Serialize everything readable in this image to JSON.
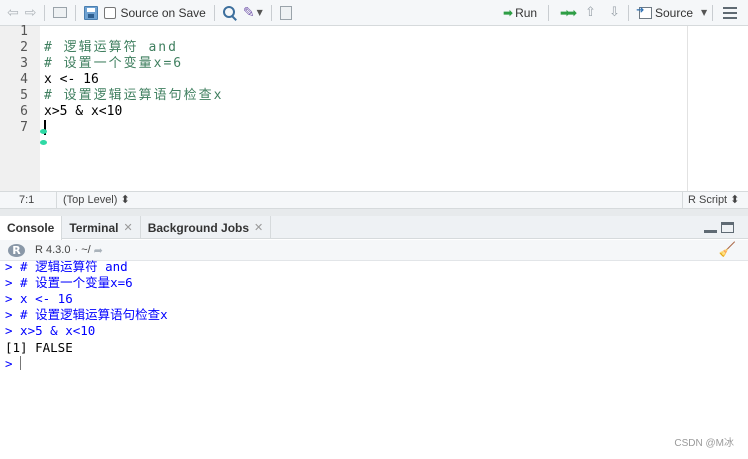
{
  "toolbar": {
    "source_on_save_label": "Source on Save",
    "run_label": "Run",
    "source_label": "Source"
  },
  "editor": {
    "lines": [
      {
        "num": "1",
        "text": ""
      },
      {
        "num": "2",
        "text": "# 逻辑运算符 and"
      },
      {
        "num": "3",
        "text": "# 设置一个变量x=6"
      },
      {
        "num": "4",
        "text": "x <- 16"
      },
      {
        "num": "5",
        "text": "# 设置逻辑运算语句检查x"
      },
      {
        "num": "6",
        "text": "x>5 & x<10"
      },
      {
        "num": "7",
        "text": ""
      }
    ]
  },
  "statusbar": {
    "position": "7:1",
    "scope": "(Top Level) ⬍",
    "file_type": "R Script ⬍"
  },
  "tabs": [
    {
      "label": "Console"
    },
    {
      "label": "Terminal"
    },
    {
      "label": "Background Jobs"
    }
  ],
  "console_header": {
    "r_version": "R 4.3.0",
    "wd": "· ~/"
  },
  "console": {
    "lines": [
      {
        "prompt": ">",
        "text": " # 逻辑运算符 and"
      },
      {
        "prompt": ">",
        "text": " # 设置一个变量x=6"
      },
      {
        "prompt": ">",
        "text": " x <- 16"
      },
      {
        "prompt": ">",
        "text": " # 设置逻辑运算语句检查x"
      },
      {
        "prompt": ">",
        "text": " x>5 & x<10"
      },
      {
        "prompt": "",
        "text": "[1] FALSE"
      },
      {
        "prompt": ">",
        "text": ""
      }
    ]
  },
  "watermark": "CSDN @M冰"
}
